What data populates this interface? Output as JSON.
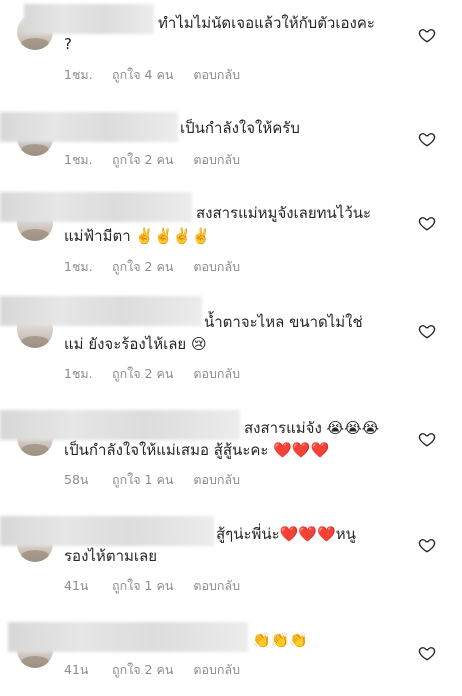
{
  "comments": [
    {
      "lines": [
        "ทำไมไม่นัดเจอแล้วให้กับตัวเองคะ",
        "?"
      ],
      "time": "1ชม.",
      "likes": "ถูกใจ 4 คน",
      "reply": "ตอบกลับ"
    },
    {
      "lines": [
        "เป็นกำลังใจให้ครับ"
      ],
      "time": "1ชม.",
      "likes": "ถูกใจ 2 คน",
      "reply": "ตอบกลับ"
    },
    {
      "lines": [
        "สงสารแม่หมูจังเลยทนไว้นะ",
        "แม่ฟ้ามีตา ✌️✌️✌️✌️"
      ],
      "time": "1ชม.",
      "likes": "ถูกใจ 2 คน",
      "reply": "ตอบกลับ"
    },
    {
      "lines": [
        "น้ำตาจะไหล ขนาดไม่ใช่",
        "แม่ ยังจะร้องไห้เลย 😢"
      ],
      "time": "1ชม.",
      "likes": "ถูกใจ 2 คน",
      "reply": "ตอบกลับ"
    },
    {
      "lines": [
        "สงสารแม่จัง 😭😭😭",
        "เป็นกำลังใจให้แม่เสมอ สู้สู้นะคะ ❤️❤️❤️"
      ],
      "time": "58น",
      "likes": "ถูกใจ 1 คน",
      "reply": "ตอบกลับ"
    },
    {
      "lines": [
        "สู้ๆน่ะพี่น่ะ❤️❤️❤️หนู",
        "รองไห้ตามเลย"
      ],
      "time": "41น",
      "likes": "ถูกใจ 1 คน",
      "reply": "ตอบกลับ"
    },
    {
      "lines": [
        "👏👏👏"
      ],
      "time": "41น",
      "likes": "ถูกใจ 2 คน",
      "reply": "ตอบกลับ"
    }
  ],
  "icons": {
    "like": "heart-outline-icon"
  },
  "colors": {
    "text": "#262626",
    "meta": "#8e8e8e",
    "blur": "#dcdcdc"
  }
}
